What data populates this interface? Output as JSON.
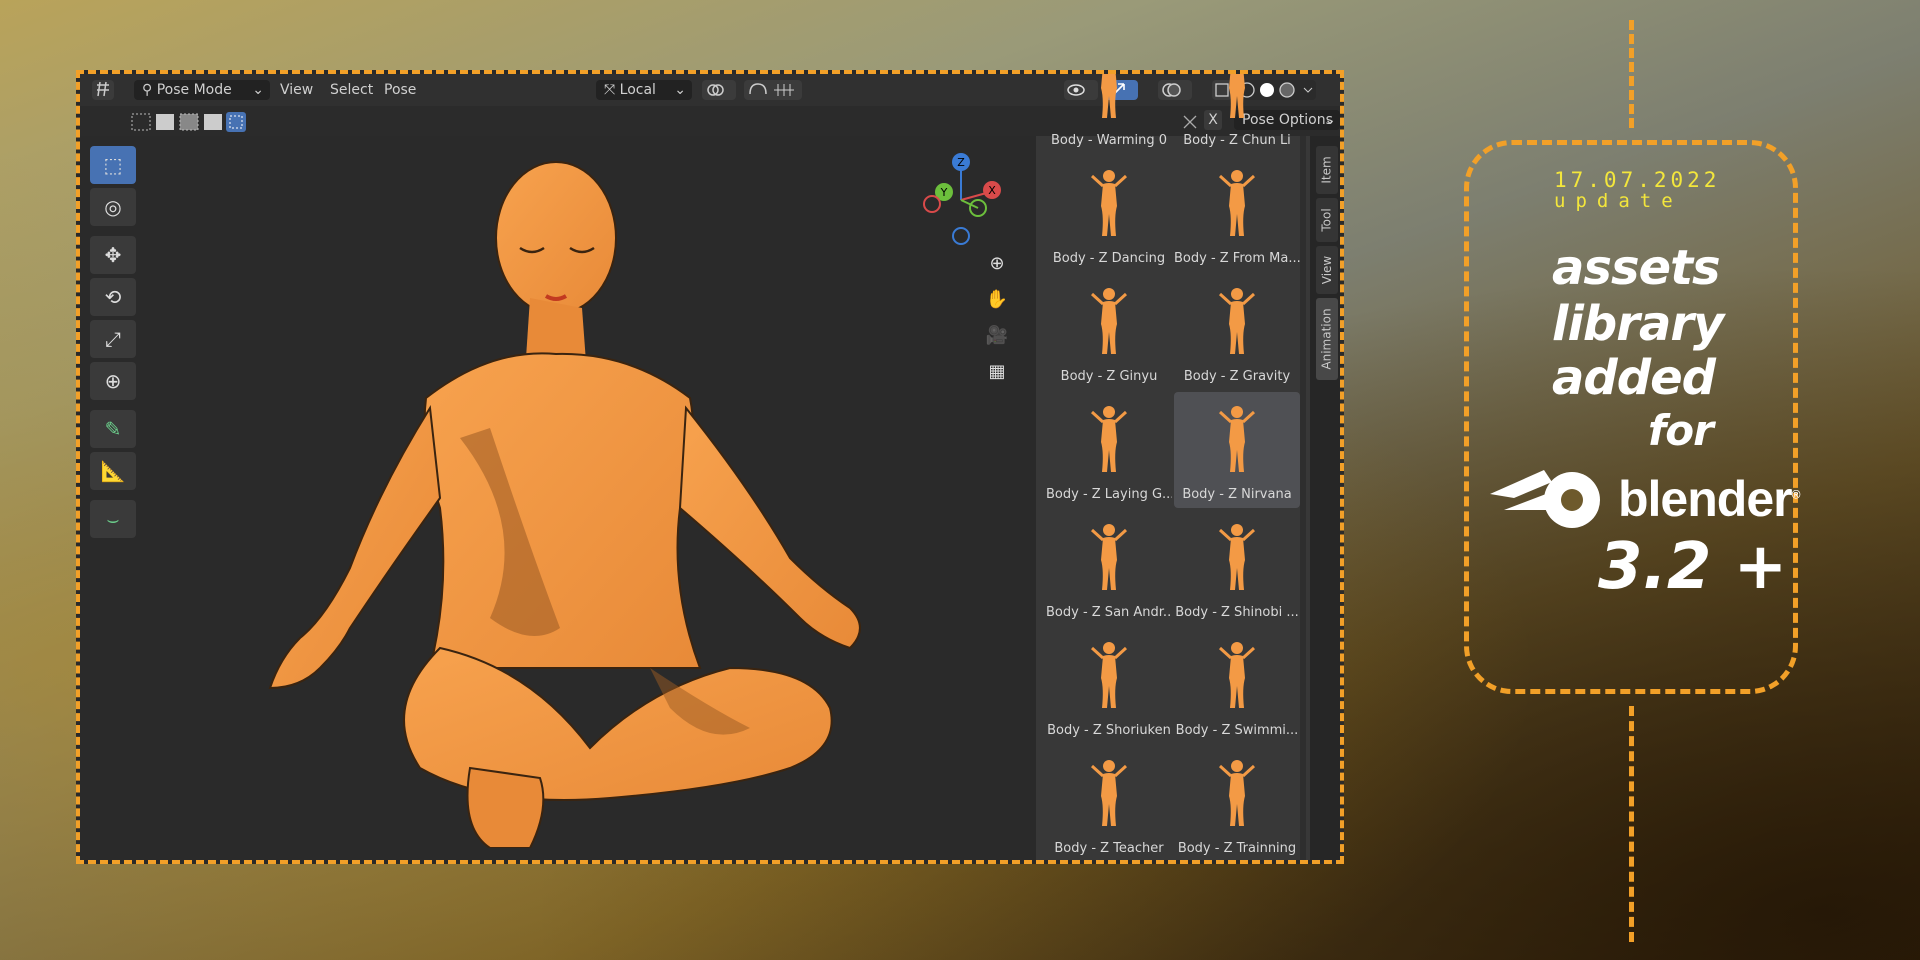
{
  "header": {
    "mode": "Pose Mode",
    "menu": [
      "View",
      "Select",
      "Pose"
    ],
    "transform_orientation": "Local",
    "pose_options": "Pose Options",
    "x_label": "X"
  },
  "sidebar_tabs": [
    "Item",
    "Tool",
    "View",
    "Animation"
  ],
  "gizmo": {
    "z": "Z",
    "y": "Y",
    "x": "X"
  },
  "assets": [
    {
      "label": "Body - Warming 0"
    },
    {
      "label": "Body - Z Chun Li"
    },
    {
      "label": "Body - Z Dancing"
    },
    {
      "label": "Body - Z From Ma..."
    },
    {
      "label": "Body - Z Ginyu"
    },
    {
      "label": "Body - Z Gravity"
    },
    {
      "label": "Body - Z Laying G..."
    },
    {
      "label": "Body - Z Nirvana",
      "selected": true
    },
    {
      "label": "Body - Z San Andr..."
    },
    {
      "label": "Body - Z Shinobi ..."
    },
    {
      "label": "Body - Z Shoriuken"
    },
    {
      "label": "Body - Z Swimmi..."
    },
    {
      "label": "Body - Z Teacher"
    },
    {
      "label": "Body - Z Trainning"
    }
  ],
  "promo": {
    "date": "17.07.2022",
    "update": "update",
    "line1": "assets",
    "line2": "library",
    "line3": "added",
    "line4": "for",
    "brand": "blender",
    "registered": "®",
    "version": "3.2 +"
  },
  "colors": {
    "accent": "#f2a028",
    "skin": "#f39a45",
    "date": "#f3e63c",
    "selected_tool": "#4772b3"
  }
}
